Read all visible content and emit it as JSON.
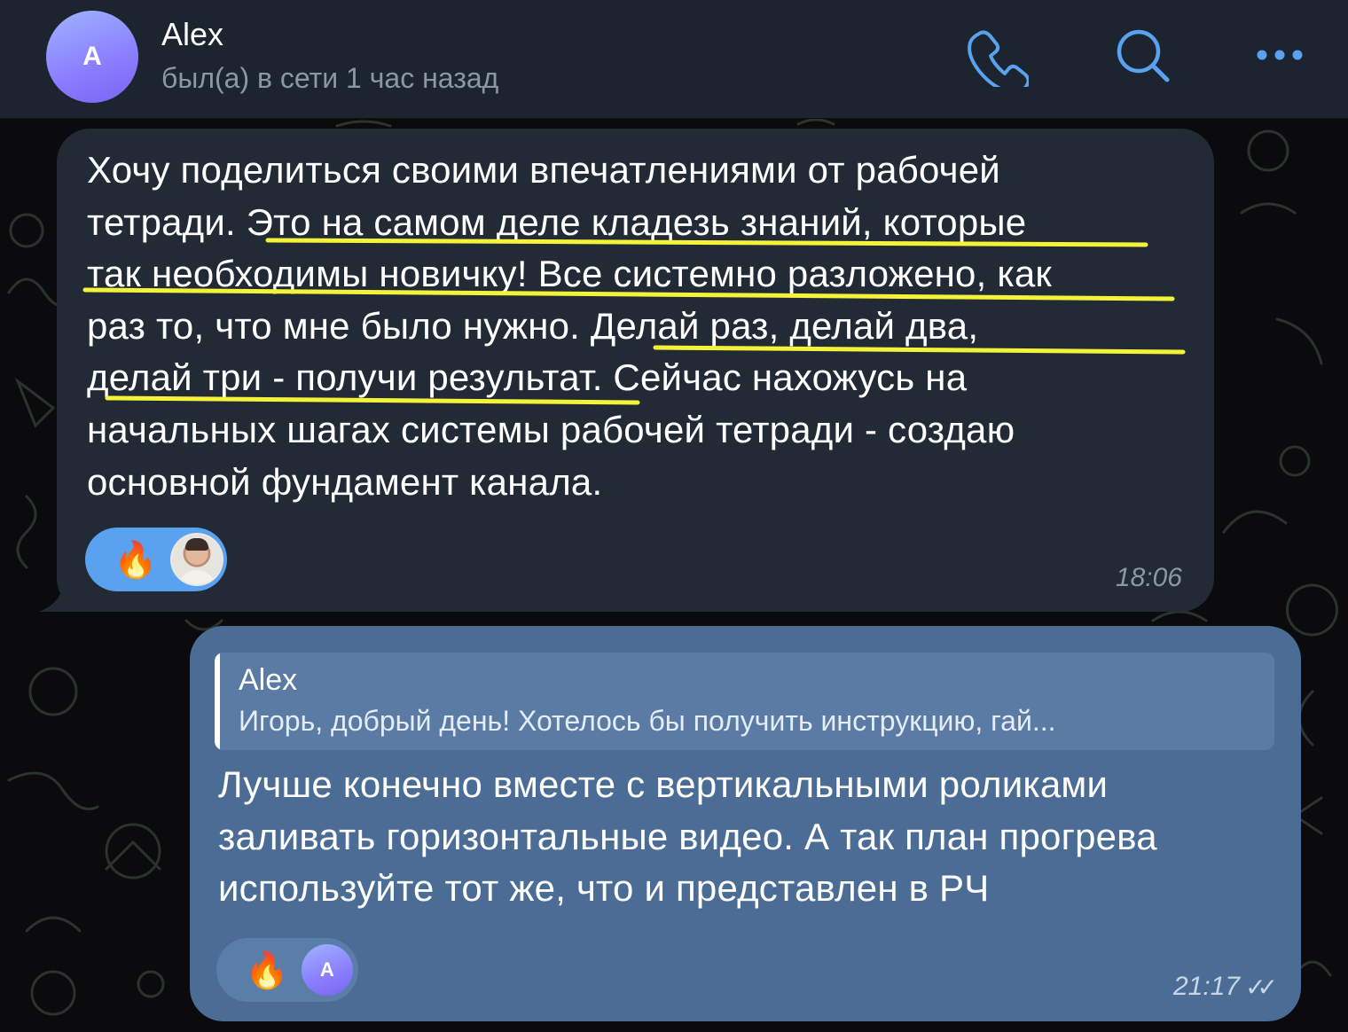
{
  "colors": {
    "header_bg": "#1c2430",
    "incoming_bubble": "#222a36",
    "outgoing_bubble": "#4b6c95",
    "accent_blue": "#5aa1ef",
    "highlight_yellow": "#f5f23a",
    "status_gray": "#8b96a6"
  },
  "header": {
    "avatar_letter": "A",
    "name": "Alex",
    "status": "был(а) в сети 1 час назад",
    "icons": [
      "phone-icon",
      "search-icon",
      "more-icon"
    ]
  },
  "incoming": {
    "lines": [
      "Хочу поделиться своими впечатлениями от рабочей",
      "тетради. Это на самом деле кладезь знаний, которые",
      "так необходимы новичку! Все системно разложено, как",
      "раз то, что мне было нужно. Делай раз, делай два,",
      "делай три - получи результат. Сейчас нахожусь на",
      "начальных шагах системы рабочей тетради - создаю",
      "основной фундамент канала."
    ],
    "reaction_emoji": "🔥",
    "time": "18:06"
  },
  "outgoing": {
    "reply_name": "Alex",
    "reply_text": "Игорь, добрый день! Хотелось бы получить инструкцию, гай...",
    "lines": [
      "Лучше конечно вместе с вертикальными роликами",
      "заливать горизонтальные видео. А так план прогрева",
      "используйте тот же, что и представлен в РЧ"
    ],
    "reaction_emoji": "🔥",
    "reaction_avatar_letter": "A",
    "time": "21:17",
    "checks": "✓✓"
  }
}
